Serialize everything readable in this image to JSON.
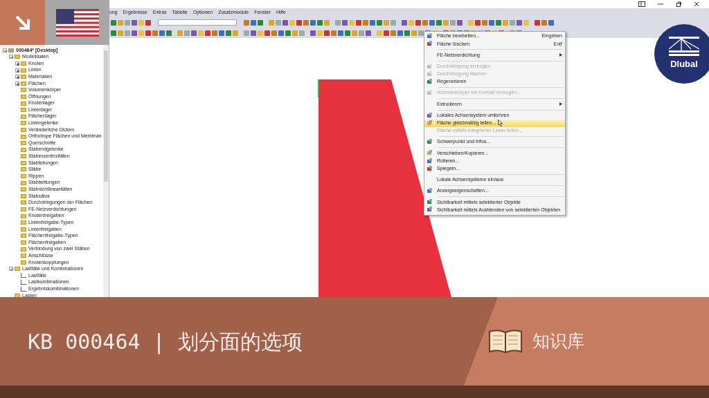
{
  "menu_bar": {
    "items": [
      "ung",
      "Ergebnisse",
      "Extras",
      "Tabelle",
      "Optionen",
      "Zusatzmodule",
      "Fenster",
      "Hilfe"
    ]
  },
  "tree": [
    {
      "label": "000464* [Desktop]",
      "kind": "root",
      "expanded": true,
      "children": [
        {
          "label": "Modelldaten",
          "expanded": true,
          "children": [
            {
              "label": "Knoten",
              "expanded": false
            },
            {
              "label": "Linien",
              "expanded": false
            },
            {
              "label": "Materialien",
              "expanded": false
            },
            {
              "label": "Flächen",
              "expanded": false
            },
            {
              "label": "Volumenkörper"
            },
            {
              "label": "Öffnungen"
            },
            {
              "label": "Knotenlager"
            },
            {
              "label": "Linienlager"
            },
            {
              "label": "Flächenlager"
            },
            {
              "label": "Liniengelenke"
            },
            {
              "label": "Veränderliche Dicken"
            },
            {
              "label": "Orthotrope Flächen und Membran"
            },
            {
              "label": "Querschnitte"
            },
            {
              "label": "Stabendgelenke"
            },
            {
              "label": "Stabexzentrizitäten"
            },
            {
              "label": "Stabteilungen"
            },
            {
              "label": "Stäbe"
            },
            {
              "label": "Rippen"
            },
            {
              "label": "Stabbettungen"
            },
            {
              "label": "Stabnichtlinearitäten"
            },
            {
              "label": "Stabsätze"
            },
            {
              "label": "Durchdringungen der Flächen"
            },
            {
              "label": "FE-Netzverdichtungen"
            },
            {
              "label": "Knotenfreigaben"
            },
            {
              "label": "Linienfreigabe-Typen"
            },
            {
              "label": "Linienfreigaben"
            },
            {
              "label": "Flächenfreigabe-Typen"
            },
            {
              "label": "Flächenfreigaben"
            },
            {
              "label": "Verbindung von zwei Stäben"
            },
            {
              "label": "Anschlüsse"
            },
            {
              "label": "Knotenkopplungen"
            }
          ]
        },
        {
          "label": "Lastfälle und Kombinationen",
          "expanded": true,
          "children": [
            {
              "label": "Lastfälle",
              "kind": "loadcase"
            },
            {
              "label": "Lastkombinationen",
              "kind": "loadcase"
            },
            {
              "label": "Ergebniskombinationen",
              "kind": "loadcase"
            }
          ]
        },
        {
          "label": "Lasten"
        }
      ]
    }
  ],
  "context_menu": [
    {
      "kind": "item",
      "label": "Fläche bearbeiten...",
      "shortcut": "Eingeben",
      "icon": true,
      "disabled": false,
      "selected": false
    },
    {
      "kind": "item",
      "label": "Fläche löschen",
      "shortcut": "Entf",
      "icon": true,
      "disabled": false,
      "selected": false
    },
    {
      "kind": "separator"
    },
    {
      "kind": "submenu",
      "label": "FE-Netzverdichtung",
      "disabled": false,
      "selected": false
    },
    {
      "kind": "separator"
    },
    {
      "kind": "item",
      "label": "Durchdringung erzeugen",
      "icon": true,
      "disabled": true,
      "selected": false
    },
    {
      "kind": "item",
      "label": "Durchdringung löschen",
      "icon": true,
      "disabled": true,
      "selected": false
    },
    {
      "kind": "item",
      "label": "Regenerieren",
      "icon": true,
      "disabled": false,
      "selected": false
    },
    {
      "kind": "separator"
    },
    {
      "kind": "item",
      "label": "Volumenkörper mit Kontakt erzeugen...",
      "icon": true,
      "disabled": true,
      "selected": false
    },
    {
      "kind": "separator"
    },
    {
      "kind": "submenu",
      "label": "Extrudieren",
      "disabled": false,
      "selected": false
    },
    {
      "kind": "separator"
    },
    {
      "kind": "item",
      "label": "Lokales Achsensystem umkehren",
      "icon": true,
      "disabled": false,
      "selected": false
    },
    {
      "kind": "item",
      "label": "Fläche gleichmäßig teilen...",
      "icon": true,
      "disabled": false,
      "selected": true
    },
    {
      "kind": "item",
      "label": "Fläche mittels integrierter Linien teilen...",
      "disabled": true,
      "selected": false
    },
    {
      "kind": "separator"
    },
    {
      "kind": "item",
      "label": "Schwerpunkt und Infos...",
      "icon": true,
      "disabled": false,
      "selected": false
    },
    {
      "kind": "separator"
    },
    {
      "kind": "item",
      "label": "Verschieben/Kopieren...",
      "icon": true,
      "disabled": false,
      "selected": false
    },
    {
      "kind": "item",
      "label": "Rotieren...",
      "icon": true,
      "disabled": false,
      "selected": false
    },
    {
      "kind": "item",
      "label": "Spiegeln...",
      "icon": true,
      "disabled": false,
      "selected": false
    },
    {
      "kind": "separator"
    },
    {
      "kind": "item",
      "label": "Lokale Achsensysteme ein/aus",
      "disabled": false,
      "selected": false
    },
    {
      "kind": "separator"
    },
    {
      "kind": "item",
      "label": "Anzeigeeigenschaften...",
      "icon": true,
      "disabled": false,
      "selected": false
    },
    {
      "kind": "separator"
    },
    {
      "kind": "item",
      "label": "Sichtbarkeit mittels selektierter Objekte",
      "icon": true,
      "disabled": false,
      "selected": false
    },
    {
      "kind": "item",
      "label": "Sichtbarkeit mittels Ausblenden von selektierten Objekten",
      "icon": true,
      "disabled": false,
      "selected": false
    }
  ],
  "logo": {
    "text": "Dlubal"
  },
  "banner": {
    "title": "KB 000464 | 划分面的选项",
    "category": "知识库"
  }
}
